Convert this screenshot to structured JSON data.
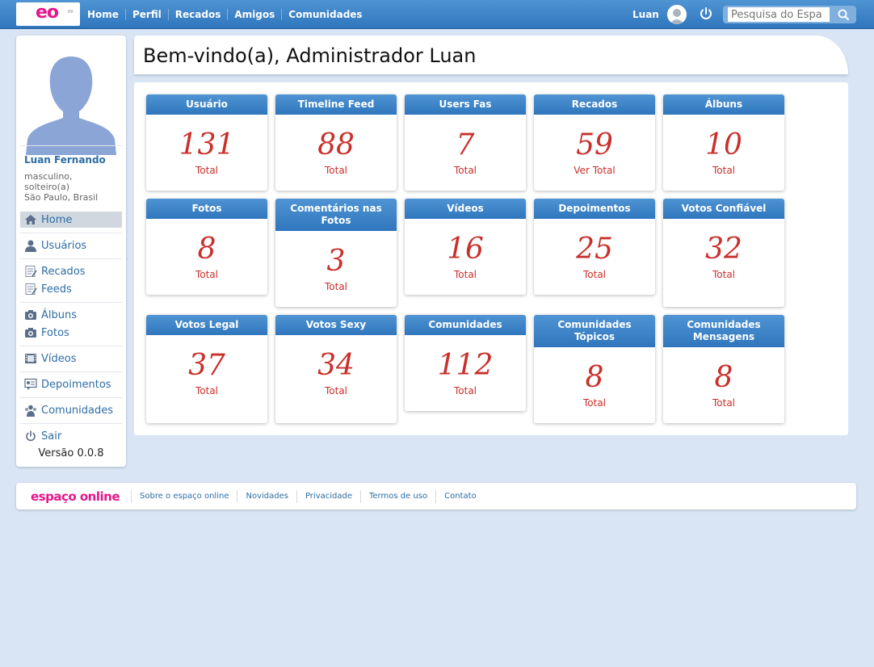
{
  "topbar": {
    "logo": "eo",
    "logo_small": "BR",
    "nav": [
      "Home",
      "Perfil",
      "Recados",
      "Amigos",
      "Comunidades"
    ],
    "user_name": "Luan",
    "search_placeholder": "Pesquisa do Espa"
  },
  "sidebar": {
    "profile_name": "Luan Fernando",
    "profile_info": [
      "masculino,",
      "solteiro(a)",
      "São Paulo, Brasil"
    ],
    "menu": {
      "home": "Home",
      "usuarios": "Usuários",
      "recados": "Recados",
      "feeds": "Feeds",
      "albuns": "Álbuns",
      "fotos": "Fotos",
      "videos": "Vídeos",
      "depoimentos": "Depoimentos",
      "comunidades": "Comunidades",
      "sair": "Sair"
    },
    "version": "Versão 0.0.8"
  },
  "welcome": {
    "title": "Bem-vindo(a), Administrador Luan"
  },
  "cards": [
    {
      "title": "Usuário",
      "value": "131",
      "label": "Total"
    },
    {
      "title": "Timeline Feed",
      "value": "88",
      "label": "Total"
    },
    {
      "title": "Users Fas",
      "value": "7",
      "label": "Total"
    },
    {
      "title": "Recados",
      "value": "59",
      "label": "Ver Total"
    },
    {
      "title": "Álbuns",
      "value": "10",
      "label": "Total"
    },
    {
      "title": "Fotos",
      "value": "8",
      "label": "Total"
    },
    {
      "title": "Comentários nas Fotos",
      "value": "3",
      "label": "Total"
    },
    {
      "title": "Vídeos",
      "value": "16",
      "label": "Total"
    },
    {
      "title": "Depoimentos",
      "value": "25",
      "label": "Total"
    },
    {
      "title": "Votos Confiável",
      "value": "32",
      "label": "Total"
    },
    {
      "title": "Votos Legal",
      "value": "37",
      "label": "Total"
    },
    {
      "title": "Votos Sexy",
      "value": "34",
      "label": "Total"
    },
    {
      "title": "Comunidades",
      "value": "112",
      "label": "Total"
    },
    {
      "title": "Comunidades Tópicos",
      "value": "8",
      "label": "Total"
    },
    {
      "title": "Comunidades Mensagens",
      "value": "8",
      "label": "Total"
    }
  ],
  "footer": {
    "logo": "espaço online",
    "links": [
      "Sobre o espaço online",
      "Novidades",
      "Privacidade",
      "Termos de uso",
      "Contato"
    ]
  },
  "colors": {
    "brand_pink": "#e5178a",
    "header_blue": "#2f76bd",
    "value_red": "#c9302c",
    "page_bg": "#d9e5f5"
  }
}
